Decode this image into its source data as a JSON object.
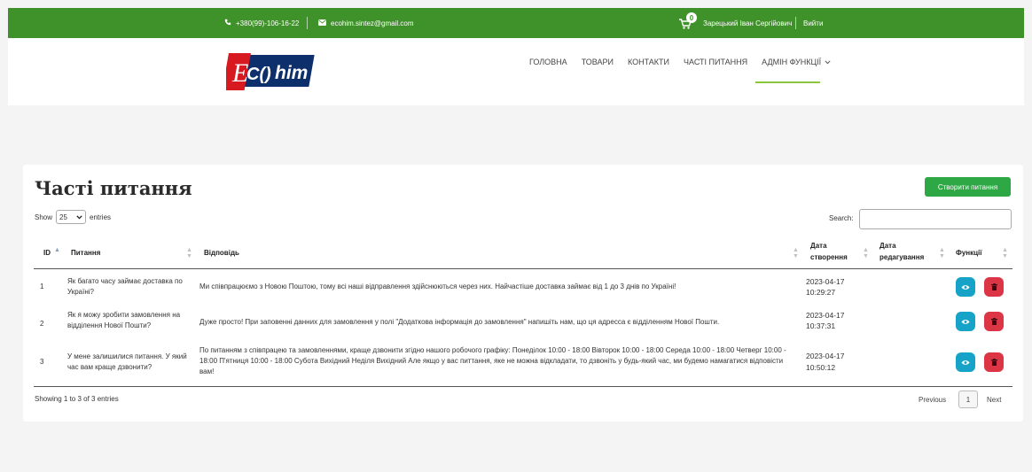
{
  "topbar": {
    "phone": "+380(99)-106-16-22",
    "email": "ecohim.sintez@gmail.com",
    "cart_count": "0",
    "user_name": "Зарецький Іван Сергійович",
    "logout": "Вийти",
    "bg_color": "#3f9229"
  },
  "header": {
    "logo_text_e": "E",
    "logo_text_co": "C()",
    "logo_text_him": "him",
    "nav": [
      "ГОЛОВНА",
      "ТОВАРИ",
      "КОНТАКТИ",
      "ЧАСТІ ПИТАННЯ",
      "АДМІН ФУНКЦІЇ"
    ],
    "active_index": 4
  },
  "page": {
    "title": "Часті питання",
    "create_button": "Створити питання"
  },
  "table_controls": {
    "show": "Show",
    "length_value": "25",
    "entries": "entries",
    "search_label": "Search:",
    "search_value": ""
  },
  "table": {
    "columns": {
      "id": "ID",
      "question": "Питання",
      "answer": "Відповідь",
      "created_l1": "Дата",
      "created_l2": "створення",
      "edited_l1": "Дата",
      "edited_l2": "редагування",
      "actions": "Функції"
    },
    "rows": [
      {
        "id": "1",
        "question": "Як багато часу займає доставка по Україні?",
        "answer": "Ми співпрацюємо з Новою Поштою, тому всі наші відправлення здійснюються через них. Найчастіше доставка займає від 1 до 3 днів по Україні!",
        "created_date": "2023-04-17",
        "created_time": "10:29:27",
        "edited": ""
      },
      {
        "id": "2",
        "question": "Як я можу зробити замовлення на відділення Нової Пошти?",
        "answer": "Дуже просто! При заповенні данних для замовлення у полі \"Додаткова інформація до замовлення\" напишіть нам, що ця адресса є відділенням Нової Пошти.",
        "created_date": "2023-04-17",
        "created_time": "10:37:31",
        "edited": ""
      },
      {
        "id": "3",
        "question": "У мене залишилися питання. У який час вам краще дзвонити?",
        "answer": "По питанням з співпрацею та замовленнями, краще дзвонити згідно нашого робочого графіку: Понеділок 10:00 - 18:00 Вівторок 10:00 - 18:00 Середа 10:00 - 18:00 Четверг 10:00 - 18:00 П'ятниця 10:00 - 18:00 Субота Вихідний Неділя Вихідний Але якщо у вас питтання, яке не можна відкладати, то дзвоніть у будь-який час, ми будемо намагатися відповісти вам!",
        "created_date": "2023-04-17",
        "created_time": "10:50:12",
        "edited": ""
      }
    ]
  },
  "footer": {
    "info": "Showing 1 to 3 of 3 entries",
    "previous": "Previous",
    "page": "1",
    "next": "Next"
  },
  "colors": {
    "accent_green": "#3f9229",
    "create_green": "#2ea745",
    "view_cyan": "#17a2c8",
    "delete_red": "#dc3545",
    "logo_red": "#d71920"
  },
  "icons": [
    "phone-icon",
    "envelope-icon",
    "cart-icon",
    "chevron-down-icon",
    "eye-icon",
    "trash-icon"
  ]
}
